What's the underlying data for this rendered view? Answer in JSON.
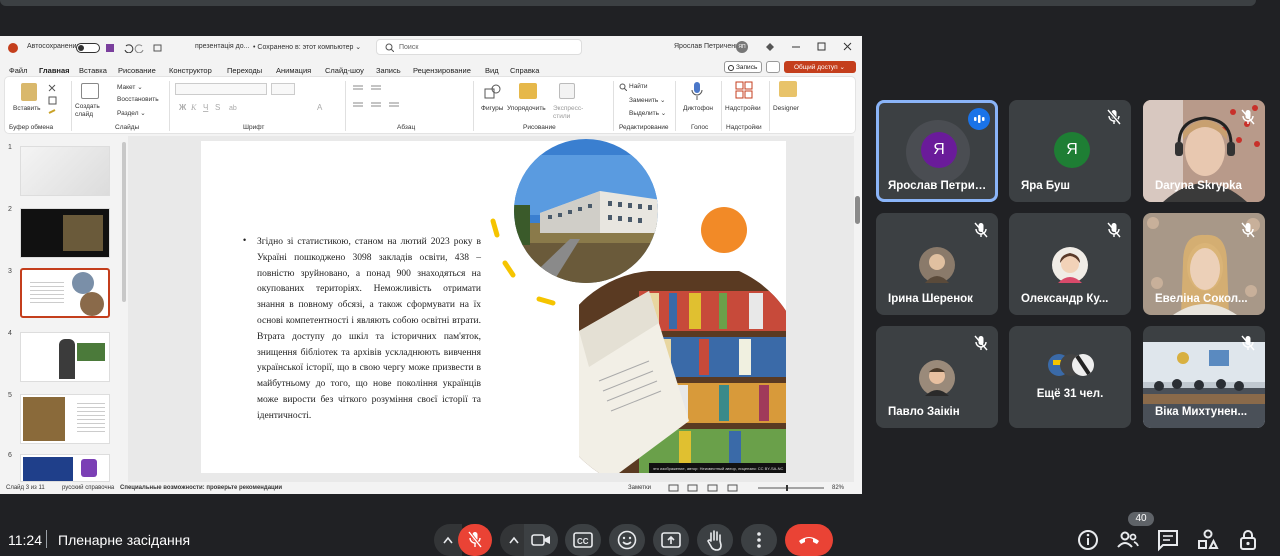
{
  "powerpoint": {
    "autosave_label": "Автосохранение",
    "file_title": "презентація до...",
    "save_status": "• Сохранено в: этот компьютер ⌄",
    "search_placeholder": "Поиск",
    "user_name": "Ярослав Петриченко",
    "user_initials": "ЯП",
    "menu": [
      "Файл",
      "Главная",
      "Вставка",
      "Рисование",
      "Конструктор",
      "Переходы",
      "Анимация",
      "Слайд-шоу",
      "Запись",
      "Рецензирование",
      "Вид",
      "Справка"
    ],
    "record_button": "Запись",
    "share_button": "Общий доступ ⌄",
    "ribbon": {
      "paste": "Вставить",
      "new_slide": "Создать слайд",
      "layout": "Макет ⌄",
      "reset": "Восстановить",
      "section": "Раздел ⌄",
      "clipboard_group": "Буфер обмена",
      "slides_group": "Слайды",
      "font_group": "Шрифт",
      "paragraph_group": "Абзац",
      "shapes": "Фигуры",
      "arrange": "Упорядочить",
      "quick_styles": "Экспресс-стили",
      "drawing_group": "Рисование",
      "find": "Найти",
      "replace": "Заменить ⌄",
      "select": "Выделить ⌄",
      "editing_group": "Редактирование",
      "dictate": "Диктофон",
      "voice_group": "Голос",
      "addins": "Надстройки",
      "addins_group": "Надстройки",
      "designer": "Designer"
    },
    "slide_numbers": [
      "1",
      "2",
      "3",
      "4",
      "5",
      "6"
    ],
    "slide_text": "Згідно зі статистикою, станом на лютий 2023 року в Україні пошкоджено 3098 закладів освіти, 438 – повністю зруйновано, а понад 900 знаходяться на окупованих територіях. Неможливість отримати знання в повному обсязі, а також сформувати на їх основі компетентності і являють собою освітні втрати. Втрата доступу до шкіл та історичних пам'яток, знищення бібліотек та архівів ускладнюють вивчення української історії, що в свою чергу може призвести в майбутньому до того, що нове покоління українців може вирости без чіткого розуміння своєї історії та ідентичності.",
    "image_caption": "это изображение, автор: Неизвестный автор, лицензия: CC BY-SA-NC",
    "status": {
      "slide_counter": "Слайд 3 из 11",
      "language": "русский справочна",
      "accessibility": "Специальные возможности: проверьте рекомендации",
      "notes": "Заметки",
      "zoom": "82%"
    }
  },
  "participants": [
    {
      "name": "Ярослав Петриче...",
      "initial": "Я",
      "avatar_color": "#6a1b9a",
      "speaking": true
    },
    {
      "name": "Яра Буш",
      "initial": "Я",
      "avatar_color": "#1e7e34",
      "muted": true
    },
    {
      "name": "Daryna Skrypka",
      "muted": true,
      "video": true
    },
    {
      "name": "Ірина Шеренок",
      "muted": true
    },
    {
      "name": "Олександр Ку...",
      "muted": true
    },
    {
      "name": "Евеліна Сокол...",
      "muted": true,
      "video": true
    },
    {
      "name": "Павло Заікін",
      "muted": true
    },
    {
      "name": "Ещё 31 чел."
    },
    {
      "name": "Віка Михтунен...",
      "muted": true,
      "video": true
    }
  ],
  "meeting": {
    "time": "11:24",
    "title": "Пленарне засідання",
    "participant_count": "40",
    "end_call_color": "#ea4335",
    "mic_off_color": "#ea4335"
  }
}
